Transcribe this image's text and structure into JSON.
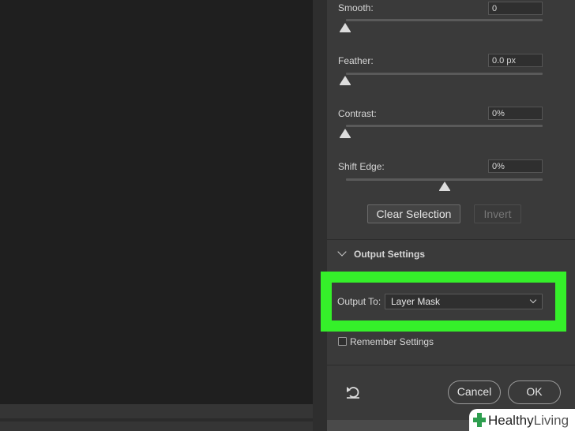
{
  "refine": {
    "smooth": {
      "label": "Smooth:",
      "value": "0",
      "slider": 0
    },
    "feather": {
      "label": "Feather:",
      "value": "0.0 px",
      "slider": 0
    },
    "contrast": {
      "label": "Contrast:",
      "value": "0%",
      "slider": 0
    },
    "shift_edge": {
      "label": "Shift Edge:",
      "value": "0%",
      "slider": 0.5
    }
  },
  "buttons": {
    "clear_selection": "Clear Selection",
    "invert": "Invert",
    "cancel": "Cancel",
    "ok": "OK"
  },
  "output_settings": {
    "title": "Output Settings",
    "output_to_label": "Output To:",
    "output_to_value": "Layer Mask",
    "remember_label": "Remember Settings",
    "remember_checked": false
  },
  "colors": {
    "highlight": "#35f02a",
    "panel": "#3a3a3a",
    "canvas": "#1f1f1f"
  },
  "icons": {
    "reset": "reset-icon",
    "expand": "chevron-down-icon",
    "dropdown": "chevron-down-icon",
    "brand": "medical-cross-icon"
  },
  "watermark": {
    "brand_bold": "Healthy",
    "brand_light": "Living"
  }
}
